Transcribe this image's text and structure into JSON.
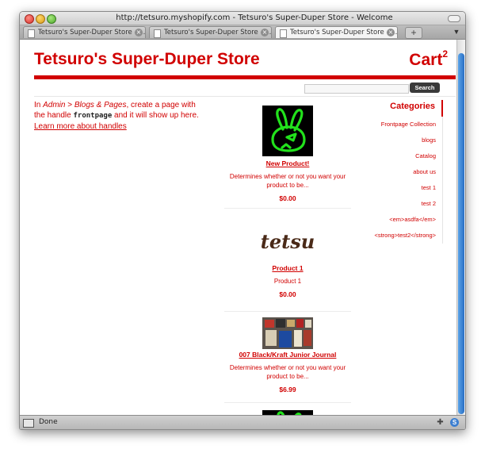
{
  "window": {
    "title": "http://tetsuro.myshopify.com - Tetsuro's Super-Duper Store - Welcome"
  },
  "tabs": [
    {
      "label": "Tetsuro's Super-Duper Store -  ..."
    },
    {
      "label": "Tetsuro's Super-Duper Store -  ..."
    },
    {
      "label": "Tetsuro's Super-Duper Store -  ..."
    }
  ],
  "new_tab_label": "+",
  "header": {
    "store_title": "Tetsuro's Super-Duper Store",
    "cart_label": "Cart",
    "cart_count": "2"
  },
  "search": {
    "placeholder": "",
    "button_label": "Search"
  },
  "intro": {
    "part1": "In ",
    "admin": "Admin",
    "arrow": " > ",
    "blogs_pages": "Blogs & Pages",
    "part2": ", create a page with the handle ",
    "handle": "frontpage",
    "part3": " and it will show up here.",
    "learn_more": "Learn more about handles"
  },
  "products": [
    {
      "title": "New Product!",
      "description": "Determines whether or not you want your product to be...",
      "price": "$0.00",
      "image": "green-rabbit-icon"
    },
    {
      "title": "Product 1",
      "description": "Product 1",
      "price": "$0.00",
      "image": "tetsu-logo"
    },
    {
      "title": "007 Black/Kraft Junior Journal",
      "description": "Determines whether or not you want your product to be...",
      "price": "$6.99",
      "image": "journal-photo"
    }
  ],
  "partial_product_image": "green-rabbit-icon",
  "tetsu_logo_text": "tetsu",
  "sidebar": {
    "heading": "Categories",
    "items": [
      {
        "label": "Frontpage Collection"
      },
      {
        "label": "blogs"
      },
      {
        "label": "Catalog"
      },
      {
        "label": "about us"
      },
      {
        "label": "test 1"
      },
      {
        "label": "test 2"
      },
      {
        "label": "<em>asdfa</em>"
      },
      {
        "label": "<strong>test2</strong>"
      }
    ]
  },
  "status": {
    "text": "Done"
  },
  "colors": {
    "brand_red": "#d10000",
    "rabbit_green": "#22e21c",
    "search_button": "#3a3a3a",
    "scroll_thumb": "#2a6fc4"
  }
}
